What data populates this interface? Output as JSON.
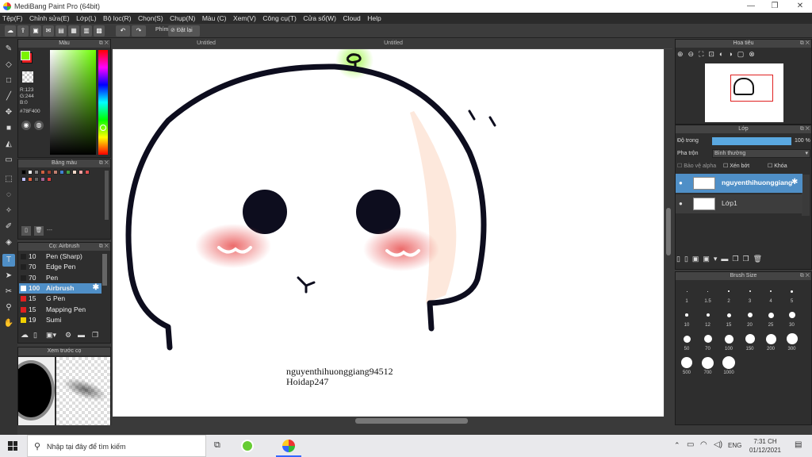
{
  "window": {
    "title": "MediBang Paint Pro (64bit)",
    "controls": [
      "—",
      "❐",
      "✕"
    ]
  },
  "menu": [
    "Tệp(F)",
    "Chỉnh sửa(E)",
    "Lớp(L)",
    "Bộ lọc(R)",
    "Chọn(S)",
    "Chụp(N)",
    "Màu (C)",
    "Xem(V)",
    "Công cụ(T)",
    "Cửa sổ(W)",
    "Cloud",
    "Help"
  ],
  "toolbar": {
    "shortcut_label": "Phím",
    "reset_label": "Đặt lại"
  },
  "color_panel": {
    "title": "Màu",
    "rgb": {
      "r": "R:123",
      "g": "G:244",
      "b": "B:0"
    },
    "hex": "#78F400",
    "fg_color": "#7bf400",
    "bg_color": "#e82020"
  },
  "palette_panel": {
    "title": "Bảng màu",
    "footer": "---",
    "swatches": [
      "#000000",
      "#ffffff",
      "#888888",
      "#d06040",
      "#a04030",
      "#c08070",
      "#4080d0",
      "#40a040",
      "#f0d8c8",
      "#f0a0a0",
      "#e05050",
      "#c0c0ff",
      "#e06040",
      "#606060",
      "#a06090",
      "#e04040"
    ]
  },
  "brush_panel": {
    "title": "Cọ: Airbrush",
    "items": [
      {
        "size": "10",
        "name": "Pen (Sharp)",
        "color": "#202020"
      },
      {
        "size": "70",
        "name": "Edge Pen",
        "color": "#202020"
      },
      {
        "size": "70",
        "name": "Pen",
        "color": "#202020"
      },
      {
        "size": "100",
        "name": "Airbrush",
        "color": "#ffffff"
      },
      {
        "size": "15",
        "name": "G Pen",
        "color": "#e02020"
      },
      {
        "size": "15",
        "name": "Mapping Pen",
        "color": "#e02020"
      },
      {
        "size": "19",
        "name": "Sumi",
        "color": "#f0d000"
      }
    ]
  },
  "preview_panel": {
    "title": "Xem trước cọ"
  },
  "canvas": {
    "tab_left": "Untitled",
    "tab_center": "Untitled",
    "watermark_line1": "nguyenthihuonggiang94512",
    "watermark_line2": "Hoidap247"
  },
  "navigator": {
    "title": "Hoa tiêu"
  },
  "layer_panel": {
    "title": "Lớp",
    "opacity_label": "Độ trong",
    "opacity_value": 100,
    "opacity_text": "100 %",
    "blend_label": "Pha trộn",
    "blend_value": "Bình thường",
    "protect_alpha": "Bảo vệ alpha",
    "clipping": "Xén bớt",
    "lock": "Khóa",
    "layers": [
      {
        "name": "nguyenthihuonggiang",
        "selected": true
      },
      {
        "name": "Lớp1",
        "selected": false
      }
    ]
  },
  "brush_size_panel": {
    "title": "Brush Size",
    "sizes": [
      "1",
      "1.5",
      "2",
      "3",
      "4",
      "5",
      "10",
      "12",
      "15",
      "20",
      "25",
      "30",
      "50",
      "70",
      "100",
      "150",
      "200",
      "300",
      "500",
      "700",
      "1000"
    ]
  },
  "taskbar": {
    "search_placeholder": "Nhập tại đây để tìm kiếm",
    "language": "ENG",
    "time": "7:31 CH",
    "date": "01/12/2021"
  }
}
